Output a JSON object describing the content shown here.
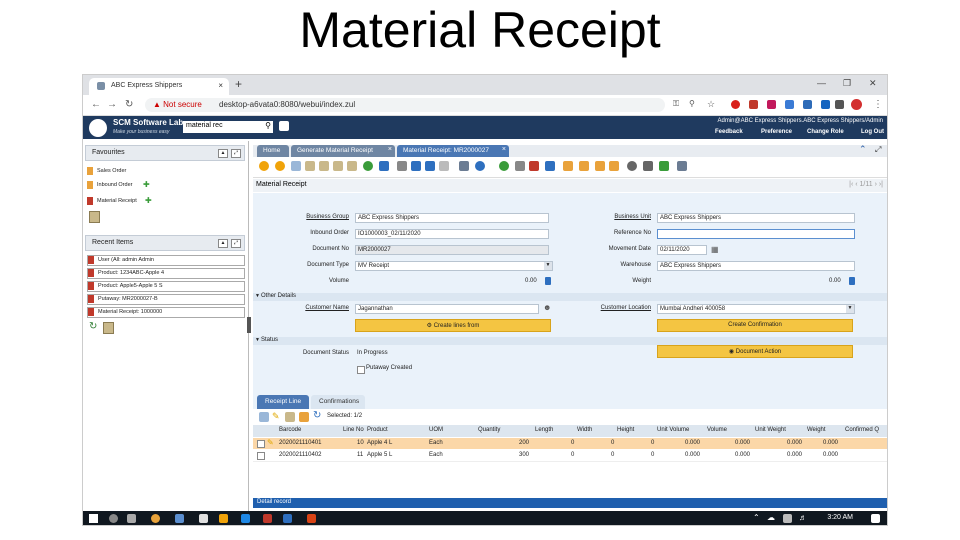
{
  "slide": {
    "title": "Material Receipt"
  },
  "browser": {
    "tab_title": "ABC Express Shippers",
    "tab_close": "×",
    "new_tab": "+",
    "warning": "Not secure",
    "url": "desktop-a6vata0:8080/webui/index.zul"
  },
  "app": {
    "brand": "SCM Software Lab",
    "tagline": "Make your business easy",
    "search_value": "material rec",
    "user_info": "Admin@ABC Express Shippers.ABC Express Shippers/Admin",
    "links": [
      "Feedback",
      "Preference",
      "Change Role",
      "Log Out"
    ]
  },
  "left_panel": {
    "favourites": {
      "title": "Favourites",
      "items": [
        "Sales Order",
        "Inbound Order",
        "Material Receipt"
      ]
    },
    "recent": {
      "title": "Recent Items",
      "items": [
        "User (All: admin Admin",
        "Product: 1234ABC-Apple 4",
        "Product: Apple5-Apple 5 S",
        "Putaway: MR2000027-B",
        "Material Receipt: 1000000"
      ]
    }
  },
  "window_tabs": [
    "Home",
    "Generate Material Receipt",
    "Material Receipt: MR2000027"
  ],
  "window": {
    "title": "Material Receipt",
    "pager": "1/11"
  },
  "form": {
    "business_group": {
      "label": "Business Group",
      "value": "ABC Express Shippers"
    },
    "business_unit": {
      "label": "Business Unit",
      "value": "ABC Express Shippers"
    },
    "inbound_order": {
      "label": "Inbound Order",
      "value": "IO1000003_02/11/2020"
    },
    "reference_no": {
      "label": "Reference No",
      "value": ""
    },
    "document_no": {
      "label": "Document No",
      "value": "MR2000027"
    },
    "movement_date": {
      "label": "Movement Date",
      "value": "02/11/2020"
    },
    "document_type": {
      "label": "Document Type",
      "value": "MV Receipt"
    },
    "warehouse": {
      "label": "Warehouse",
      "value": "ABC Express Shippers"
    },
    "volume": {
      "label": "Volume",
      "value": "0.00"
    },
    "weight": {
      "label": "Weight",
      "value": "0.00"
    }
  },
  "other_details": {
    "title": "Other Details",
    "customer_name": {
      "label": "Customer Name",
      "value": "Jagannathan"
    },
    "customer_location": {
      "label": "Customer Location",
      "value": "Mumbai Andheri 400058"
    },
    "btn_create_lines": "Create lines from",
    "btn_create_confirmation": "Create Confirmation"
  },
  "status": {
    "title": "Status",
    "document_status": {
      "label": "Document Status",
      "value": "In Progress"
    },
    "putaway_created": "Putaway Created",
    "btn_document_action": "Document Action"
  },
  "grid": {
    "tabs": [
      "Receipt Line",
      "Confirmations"
    ],
    "selected_text": "Selected: 1/2",
    "columns": [
      "Barcode",
      "Line No",
      "Product",
      "UOM",
      "Quantity",
      "Length",
      "Width",
      "Height",
      "Unit Volume",
      "Volume",
      "Unit Weight",
      "Weight",
      "Confirmed Q"
    ],
    "rows": [
      [
        "2020021110401",
        "10",
        "Apple 4 L",
        "Each",
        "200",
        "0",
        "0",
        "0",
        "0.000",
        "0.000",
        "0.000",
        "0.000",
        ""
      ],
      [
        "2020021110402",
        "11",
        "Apple 5 L",
        "Each",
        "300",
        "0",
        "0",
        "0",
        "0.000",
        "0.000",
        "0.000",
        "0.000",
        ""
      ]
    ],
    "detail_label": "Detail record"
  },
  "taskbar": {
    "time": "3:20 AM"
  }
}
